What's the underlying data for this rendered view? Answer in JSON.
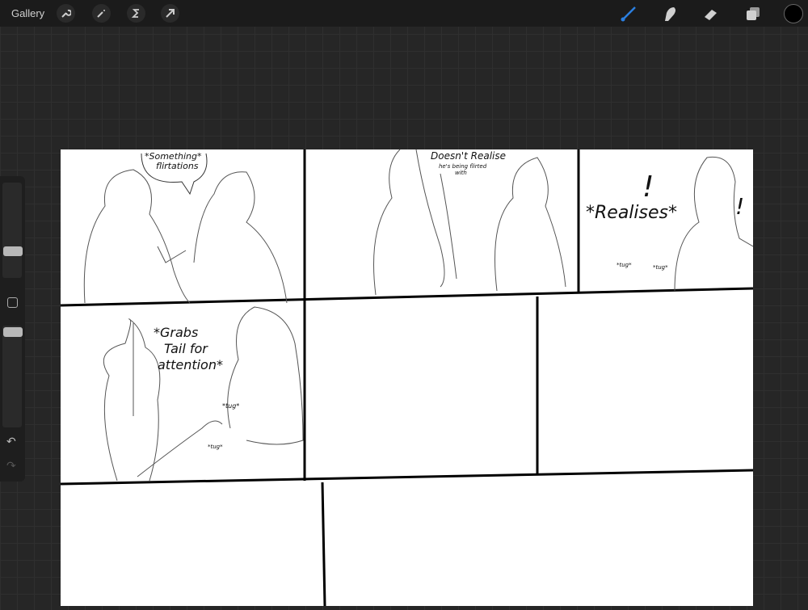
{
  "topbar": {
    "gallery": "Gallery",
    "left_tools": [
      "wrench-icon",
      "magic-wand-icon",
      "selection-s-icon",
      "transform-arrow-icon"
    ],
    "right_tools": [
      "brush-icon",
      "smudge-icon",
      "eraser-icon",
      "layers-icon"
    ],
    "active_tool": "brush",
    "accent": "#2b7fe0",
    "current_color": "#000000"
  },
  "sidebar": {
    "brush_size_level": 0.4,
    "opacity_level": 0.95,
    "undo": "↶",
    "redo": "↷"
  },
  "canvas": {
    "panels": [
      {
        "text": [
          "*Something*",
          "flirtations"
        ]
      },
      {
        "text": [
          "Doesn't Realise",
          "he's being flirted",
          "with"
        ]
      },
      {
        "text": [
          "*Realises*",
          "!",
          "!",
          "*tug*",
          "*tug*"
        ]
      },
      {
        "text": [
          "*Grabs",
          "Tail for",
          "attention*",
          "*tug*",
          "*tug*"
        ]
      }
    ]
  }
}
